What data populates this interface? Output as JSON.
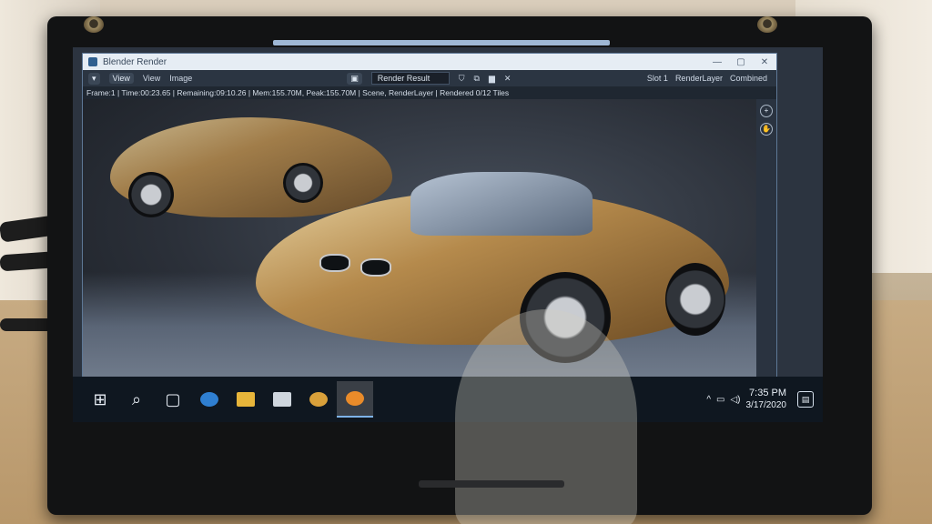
{
  "window": {
    "title": "Blender Render",
    "controls": [
      "—",
      "▢",
      "✕"
    ]
  },
  "header": {
    "editor_menu": "▾",
    "view_menu": "View",
    "view2": "View",
    "image": "Image",
    "render_result": "Render Result",
    "slot": "Slot 1",
    "layer": "RenderLayer",
    "pass": "Combined"
  },
  "status": {
    "line": "Frame:1 | Time:00:23.65 | Remaining:09:10.26 | Mem:155.70M, Peak:155.70M | Scene, RenderLayer | Rendered 0/12 Tiles"
  },
  "taskbar": {
    "start": "⊞",
    "search": "⌕",
    "taskview": "▢",
    "apps": [
      "edge-icon",
      "file-explorer-icon",
      "store-icon",
      "chrome-icon",
      "blender-icon"
    ],
    "tray_arrow": "^",
    "time": "7:35 PM",
    "date": "3/17/2020",
    "notifications": "▤"
  },
  "colors": {
    "taskbar": "#0f1720",
    "blender_header": "#2b3542",
    "accent": "#7eb3e8"
  }
}
